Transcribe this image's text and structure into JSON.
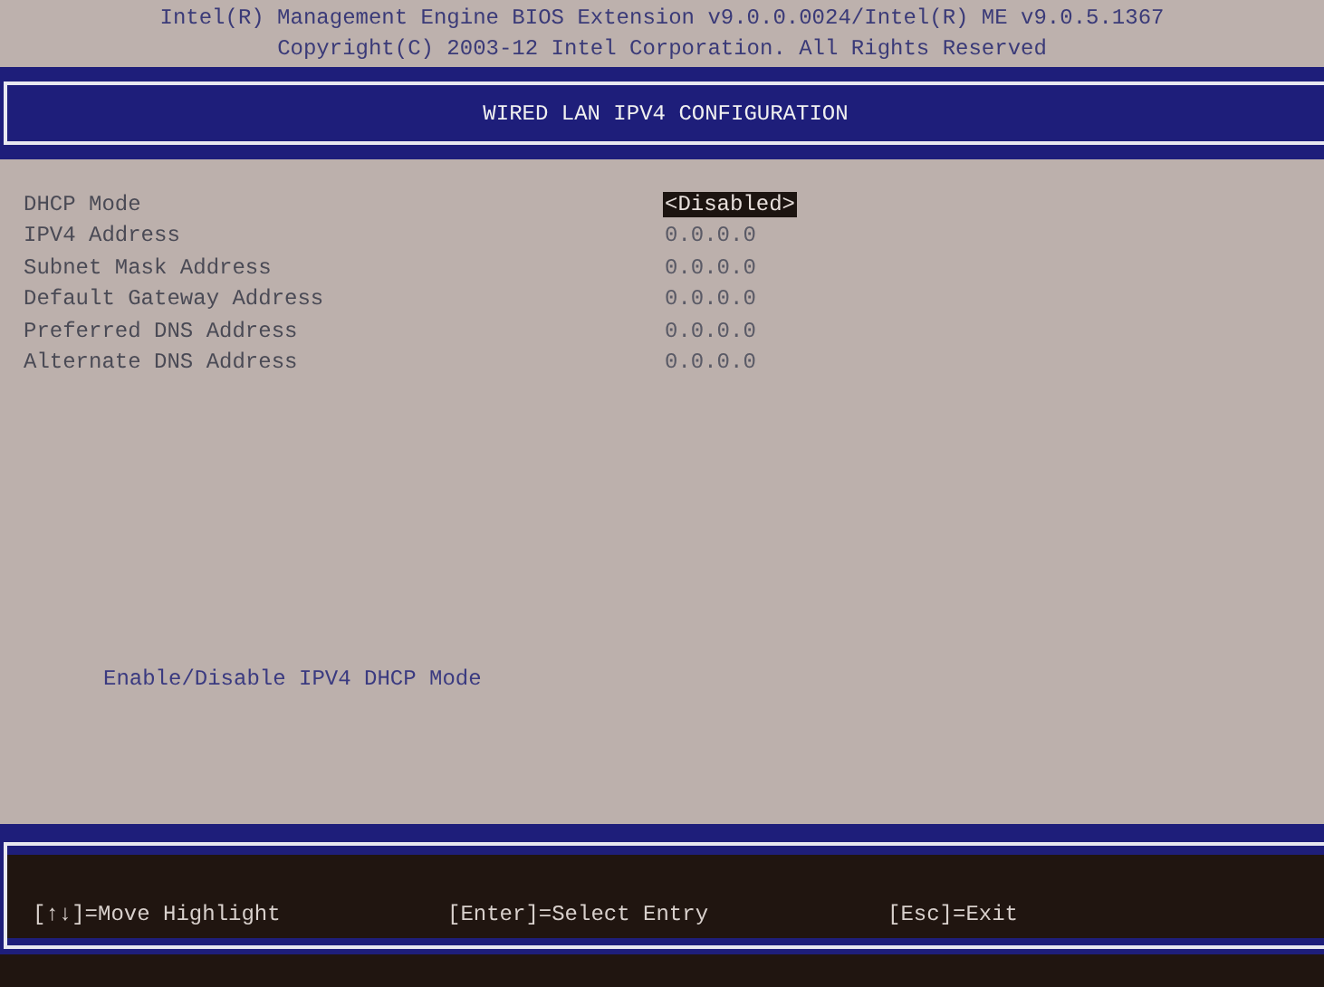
{
  "header": {
    "lines": [
      "Intel(R) Management Engine BIOS Extension v9.0.0.0024/Intel(R) ME v9.0.5.1367",
      "Copyright(C) 2003-12 Intel Corporation. All Rights Reserved"
    ]
  },
  "title": "WIRED LAN IPV4 CONFIGURATION",
  "settings": [
    {
      "label": "DHCP Mode",
      "value": "<Disabled>",
      "selected": true
    },
    {
      "label": "IPV4 Address",
      "value": "0.0.0.0",
      "selected": false
    },
    {
      "label": "Subnet Mask Address",
      "value": "0.0.0.0",
      "selected": false
    },
    {
      "label": "Default Gateway Address",
      "value": "0.0.0.0",
      "selected": false
    },
    {
      "label": "Preferred DNS Address",
      "value": "0.0.0.0",
      "selected": false
    },
    {
      "label": "Alternate DNS Address",
      "value": "0.0.0.0",
      "selected": false
    }
  ],
  "help_text": "Enable/Disable IPV4 DHCP Mode",
  "key_hints": [
    "[↑↓]=Move Highlight",
    "[Enter]=Select Entry",
    "[Esc]=Exit"
  ]
}
